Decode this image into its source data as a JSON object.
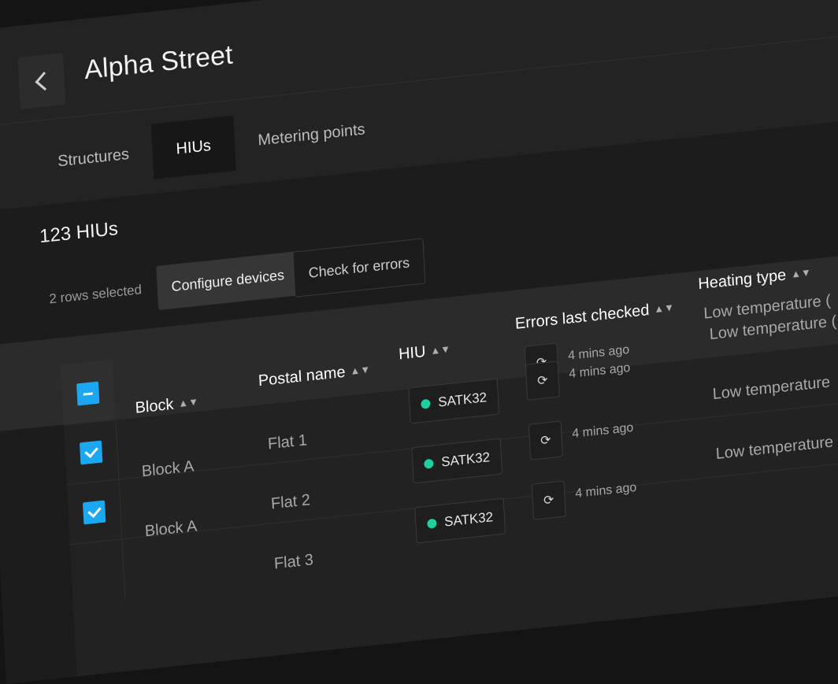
{
  "page": {
    "title": "Alpha Street"
  },
  "tabs": [
    {
      "label": "Structures",
      "active": false
    },
    {
      "label": "HIUs",
      "active": true
    },
    {
      "label": "Metering points",
      "active": false
    }
  ],
  "section": {
    "count_label": "123 HIUs"
  },
  "toolbar": {
    "selection_text": "2 rows selected",
    "configure_label": "Configure devices",
    "check_errors_label": "Check for errors"
  },
  "table": {
    "headers": {
      "block": "Block",
      "postal_name": "Postal name",
      "hiu": "HIU",
      "errors_last_checked": "Errors last checked",
      "heating_type": "Heating type"
    },
    "rows": [
      {
        "block": "Block A",
        "postal_name": "Flat 1",
        "hiu": "SATK32",
        "errors_checked": "4 mins ago",
        "heating_type": "Low temperature (",
        "selected": true
      },
      {
        "block": "Block A",
        "postal_name": "Flat 2",
        "hiu": "SATK32",
        "errors_checked": "4 mins ago",
        "heating_type": "Low temperature",
        "selected": true
      },
      {
        "block": "",
        "postal_name": "Flat 3",
        "hiu": "SATK32",
        "errors_checked": "4 mins ago",
        "heating_type": "Low temperature",
        "selected": false
      }
    ],
    "header_row_heating_type": "Low temperature (",
    "extra_errors_checked": "4 mins ago"
  },
  "colors": {
    "accent": "#1ba8f0",
    "status_ok": "#1ed0a0",
    "background": "#232323"
  },
  "icons": {
    "back": "chevron-left-icon",
    "sort": "sort-icon",
    "refresh": "refresh-icon",
    "status": "status-dot-icon"
  }
}
